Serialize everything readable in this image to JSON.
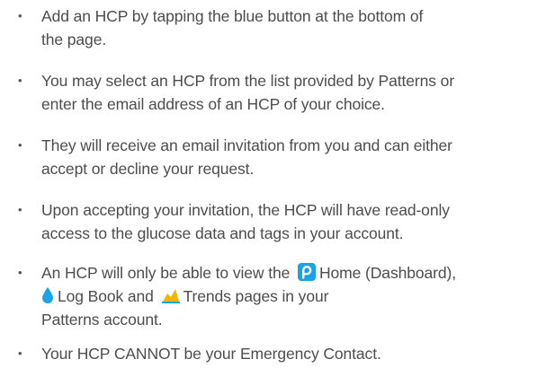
{
  "bullet_glyph": "•",
  "colors": {
    "text": "#4d4d4d",
    "accent_blue": "#1aa3e8",
    "trend_yellow": "#f2b600"
  },
  "items": [
    {
      "lines": [
        "Add an HCP by tapping the blue button at the bottom of",
        "the page."
      ]
    },
    {
      "lines": [
        "You may select an HCP from the list provided by Patterns or",
        "enter the email address of an HCP of your choice."
      ]
    },
    {
      "lines": [
        "They will receive an email invitation from you and can either",
        "accept or decline your request."
      ]
    },
    {
      "lines": [
        "Upon accepting your invitation, the HCP will have read-only",
        "access to the glucose data and tags in your account."
      ]
    },
    {
      "line1_prefix": "An HCP will only be able to view the",
      "home_label": "Home (Dashboard),",
      "logbook_label": "Log Book and",
      "trends_label": "Trends pages in your",
      "line3": "Patterns account.",
      "icons": [
        "patterns-home-icon",
        "drop-icon",
        "trends-icon"
      ]
    },
    {
      "lines": [
        "Your HCP CANNOT be your Emergency Contact."
      ]
    }
  ]
}
